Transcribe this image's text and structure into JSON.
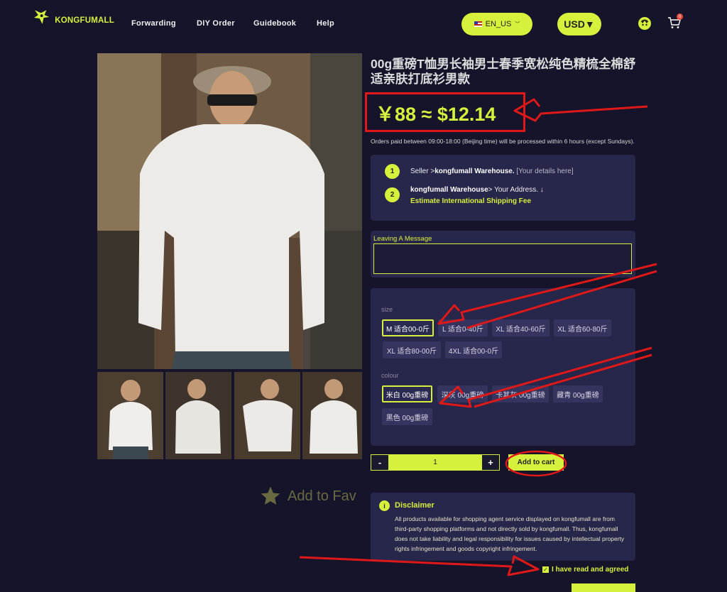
{
  "header": {
    "logo_text": "KONGFUMALL",
    "nav": [
      "Forwarding",
      "DIY Order",
      "Guidebook",
      "Help"
    ],
    "language": "EN_US",
    "currency": "USD▼",
    "cart_count": "0"
  },
  "product": {
    "title": "00g重磅T恤男长袖男士春季宽松纯色精梳全棉舒适亲肤打底衫男款",
    "price": "￥88 ≈ $12.14",
    "processing_note": "Orders paid between 09:00-18:00 (Beijing time) will be processed within 6 hours (except Sundays).",
    "add_to_fav": "Add to Fav"
  },
  "shipping": {
    "step1_number": "1",
    "step1_prefix": "Seller >",
    "step1_bold": "kongfumall Warehouse.",
    "step1_suffix": " [Your details here]",
    "step2_number": "2",
    "step2_bold": "kongfumall Warehouse",
    "step2_suffix": "> Your Address. ↓",
    "estimate": "Estimate International Shipping Fee"
  },
  "message": {
    "label": "Leaving A Message",
    "value": ""
  },
  "options": {
    "size_label": "size",
    "sizes": [
      "M 适合00-0斤",
      "L 适合0-40斤",
      "XL 适合40-60斤",
      "XL 适合60-80斤",
      "XL 适合80-00斤",
      "4XL 适合00-0斤"
    ],
    "selected_size": "M 适合00-0斤",
    "colour_label": "colour",
    "colours": [
      "米白 00g重磅",
      "深灰 00g重磅",
      "卡其灰 00g重磅",
      "藏青 00g重磅",
      "黑色 00g重磅"
    ],
    "selected_colour": "米白 00g重磅"
  },
  "cart": {
    "minus": "-",
    "quantity": "1",
    "plus": "+",
    "add_label": "Add to cart"
  },
  "disclaimer": {
    "icon": "i",
    "title": "Disclaimer",
    "text": "All products available for shopping agent service displayed on kongfumall are from third-party shopping platforms and not directly sold by kongfumall. Thus, kongfumall does not take liability and legal responsibility for issues caused by intellectual property rights infringement and goods copyright infringement.",
    "agree": "I have read and agreed"
  },
  "colors": {
    "accent": "#d7f03c",
    "background": "#15142a",
    "panel": "#27264b",
    "annotation": "#e01818"
  }
}
